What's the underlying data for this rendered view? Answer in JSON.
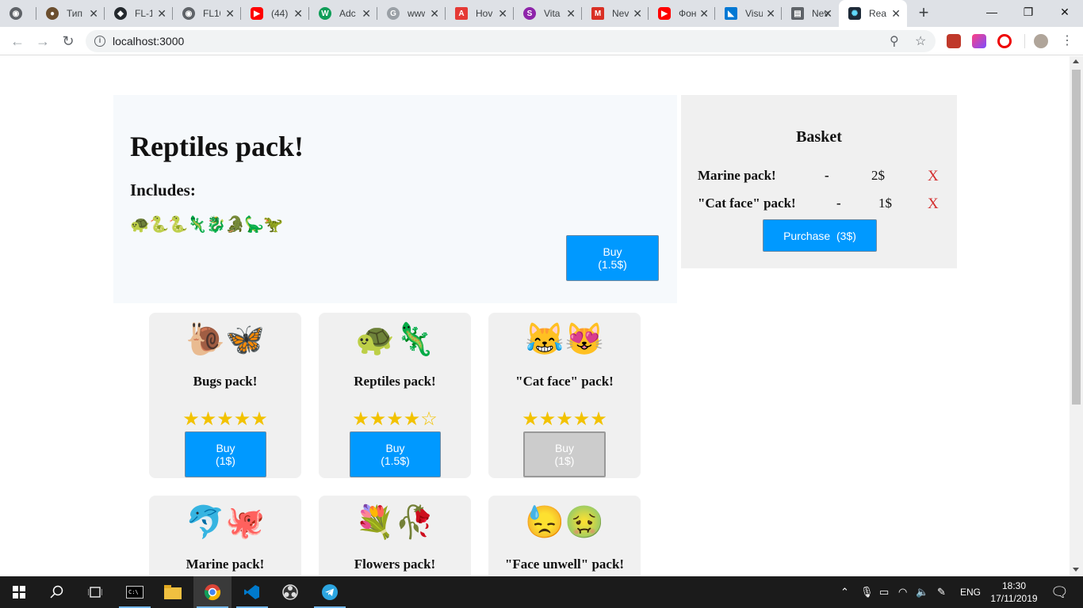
{
  "browser": {
    "tabs": [
      {
        "label": "",
        "favicon_color": "#5f6368",
        "glyph": "◉"
      },
      {
        "label": "Тип",
        "favicon_color": "#6b4e2e",
        "glyph": "●"
      },
      {
        "label": "FL-1",
        "favicon_color": "#24292e",
        "glyph": "◆"
      },
      {
        "label": "FL10",
        "favicon_color": "#5f6368",
        "glyph": "◉"
      },
      {
        "label": "(44)",
        "favicon_color": "#ff0000",
        "glyph": "▶"
      },
      {
        "label": "Adc",
        "favicon_color": "#0f9d58",
        "glyph": "W"
      },
      {
        "label": "www",
        "favicon_color": "#9aa0a6",
        "glyph": "G"
      },
      {
        "label": "Hov",
        "favicon_color": "#e53935",
        "glyph": "A"
      },
      {
        "label": "Vita",
        "favicon_color": "#8e24aa",
        "glyph": "S"
      },
      {
        "label": "Nev",
        "favicon_color": "#d93025",
        "glyph": "M"
      },
      {
        "label": "Фон",
        "favicon_color": "#ff0000",
        "glyph": "▶"
      },
      {
        "label": "Visu",
        "favicon_color": "#0078d4",
        "glyph": "◣"
      },
      {
        "label": "Nev",
        "favicon_color": "#5f6368",
        "glyph": "▤"
      },
      {
        "label": "Rea",
        "favicon_color": "#1e2a38",
        "glyph": "✺",
        "active": true
      }
    ],
    "window_controls": {
      "minimize": "—",
      "maximize": "❐",
      "close": "✕"
    },
    "url": "localhost:3000"
  },
  "detail": {
    "title": "Reptiles pack!",
    "includes_label": "Includes:",
    "emojis": [
      "🐢",
      "🐍",
      "🐍",
      "🦎",
      "🐉",
      "🐊",
      "🦕",
      "🦖"
    ],
    "buy_line1": "Buy",
    "buy_line2": "(1.5$)"
  },
  "basket": {
    "title": "Basket",
    "items": [
      {
        "name": "Marine pack!",
        "dash": "-",
        "price": "2$",
        "remove": "X"
      },
      {
        "name": "\"Cat face\" pack!",
        "dash": "-",
        "price": "1$",
        "remove": "X"
      }
    ],
    "purchase_label": "Purchase  (3$)"
  },
  "cards": [
    {
      "title": "Bugs pack!",
      "icon": "🐌🦋",
      "stars": "★★★★★",
      "rating": 5,
      "buy1": "Buy",
      "buy2": "(1$)",
      "disabled": false
    },
    {
      "title": "Reptiles pack!",
      "icon": "🐢🦎",
      "stars": "★★★★☆",
      "rating": 4.5,
      "buy1": "Buy",
      "buy2": "(1.5$)",
      "disabled": false
    },
    {
      "title": "\"Cat face\" pack!",
      "icon": "😹😻",
      "stars": "★★★★★",
      "rating": 5,
      "buy1": "Buy",
      "buy2": "(1$)",
      "disabled": true
    },
    {
      "title": "Marine pack!",
      "icon": "🐬🐙",
      "stars": "",
      "rating": null,
      "buy1": "",
      "buy2": "",
      "disabled": false
    },
    {
      "title": "Flowers pack!",
      "icon": "💐🥀",
      "stars": "",
      "rating": null,
      "buy1": "",
      "buy2": "",
      "disabled": false
    },
    {
      "title": "\"Face unwell\" pack!",
      "icon": "😓🤢",
      "stars": "",
      "rating": null,
      "buy1": "",
      "buy2": "",
      "disabled": false
    }
  ],
  "taskbar": {
    "language": "ENG",
    "time": "18:30",
    "date": "17/11/2019"
  }
}
